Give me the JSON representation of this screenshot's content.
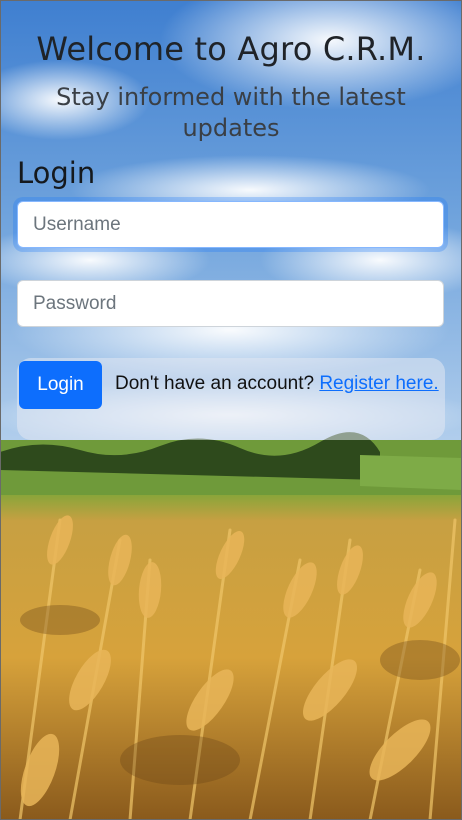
{
  "header": {
    "title": "Welcome to Agro C.R.M.",
    "subtitle": "Stay informed with the latest updates"
  },
  "login_form": {
    "heading": "Login",
    "username": {
      "placeholder": "Username",
      "value": ""
    },
    "password": {
      "placeholder": "Password",
      "value": ""
    },
    "submit_label": "Login",
    "register_prompt": "Don't have an account?",
    "register_link": "Register here."
  },
  "colors": {
    "primary": "#0d6efd",
    "focus_ring": "#86b7fe",
    "heading_text": "#1f2328"
  }
}
